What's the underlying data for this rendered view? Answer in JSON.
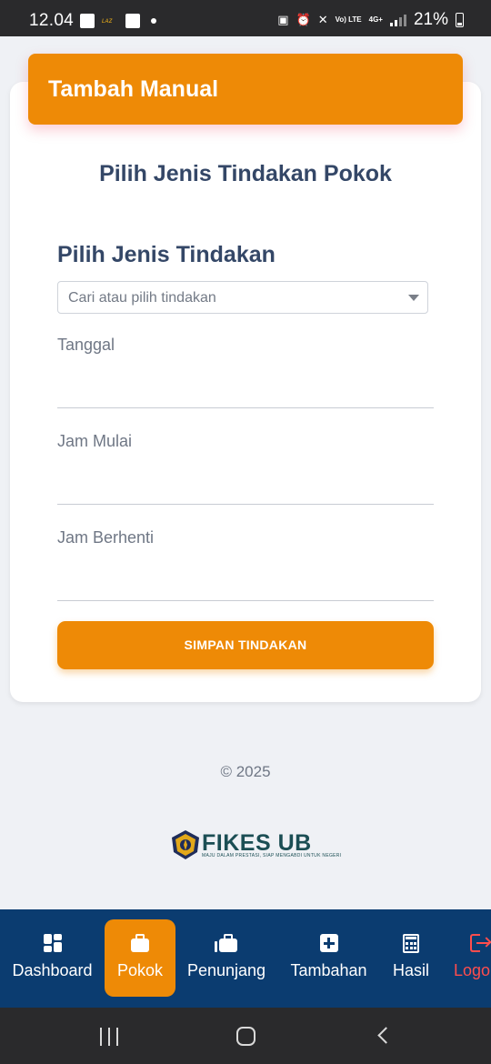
{
  "status_bar": {
    "time": "12.04",
    "network": "Vo) LTE",
    "network_type": "4G+",
    "battery": "21%"
  },
  "card": {
    "header_title": "Tambah Manual",
    "section_title": "Pilih Jenis Tindakan Pokok",
    "field_title": "Pilih Jenis Tindakan",
    "select_placeholder": "Cari atau pilih tindakan",
    "fields": [
      {
        "label": "Tanggal"
      },
      {
        "label": "Jam Mulai"
      },
      {
        "label": "Jam Berhenti"
      }
    ],
    "save_button": "SIMPAN TINDAKAN"
  },
  "footer": {
    "copyright": "© 2025",
    "logo_text": "FIKES UB",
    "logo_subtitle": "MAJU DALAM PRESTASI, SIAP MENGABDI UNTUK NEGERI"
  },
  "bottom_nav": {
    "items": [
      {
        "label": "Dashboard",
        "icon": "dashboard-grid-icon",
        "active": false
      },
      {
        "label": "Pokok",
        "icon": "briefcase-icon",
        "active": true
      },
      {
        "label": "Penunjang",
        "icon": "briefcases-icon",
        "active": false
      },
      {
        "label": "Tambahan",
        "icon": "plus-square-icon",
        "active": false
      },
      {
        "label": "Hasil",
        "icon": "calculator-icon",
        "active": false
      },
      {
        "label": "Logo",
        "icon": "logout-icon",
        "active": false
      }
    ]
  },
  "colors": {
    "accent": "#ee8a06",
    "nav_bg": "#0b3c70",
    "title_text": "#344767",
    "logout": "#ff4d4d"
  }
}
